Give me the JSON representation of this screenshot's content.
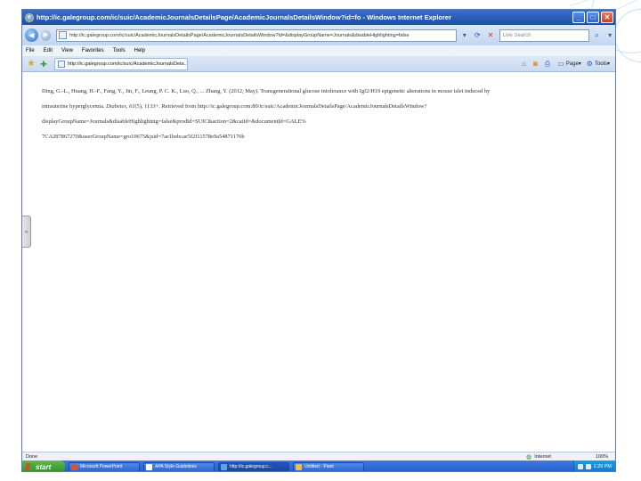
{
  "window": {
    "title": "http://ic.galegroup.com/ic/suic/AcademicJournalsDetailsPage/AcademicJournalsDetailsWindow?id=fo - Windows Internet Explorer",
    "minimize_symbol": "_",
    "maximize_symbol": "□",
    "close_symbol": "✕"
  },
  "address": {
    "url": "http://ic.galegroup.com/ic/suic/AcademicJournalsDetailsPage/AcademicJournalsDetailsWindow?id=&displayGroupName=Journals&disableHighlighting=false",
    "search_placeholder": "Live Search"
  },
  "menu": [
    "File",
    "Edit",
    "View",
    "Favorites",
    "Tools",
    "Help"
  ],
  "tab": {
    "title": "http://ic.galegroup.com/ic/suic/AcademicJournalsDeta..."
  },
  "command_bar": {
    "page_label": "Page",
    "tools_label": "Tools"
  },
  "citation": {
    "line1": "Ding, G.-L., Huang, H.-F., Fang, Y., Jin, F., Leung, P. C. K., Luo, Q., ... Zhang, Y. (2012, May). Transgenerational glucose intolerance with Igf2/H19 epigenetic alterations in mouse islet induced by",
    "line2_prefix": "intrauterine hyperglycemia. ",
    "journal": "Diabetes, 61",
    "line2_suffix": "(5), 1133+. Retrieved from http://ic.galegroup.com:80/ic/suic/AcademicJournalsDetailsPage/AcademicJournalsDetailsWindow?",
    "line3": "displayGroupName=Journals&disableHighlighting=false&prodId=SUIC&action=2&catId=&documentId=GALE%",
    "line4": "7CA287867270&userGroupName=gro10675&jsid=7ae1bebcae5f2f11578e9a54871176b"
  },
  "status": {
    "left": "Done",
    "zone": "Internet",
    "zoom": "100%"
  },
  "taskbar": {
    "start": "start",
    "tasks": [
      {
        "label": "Microsoft PowerPoint",
        "icon_color": "#d9542b"
      },
      {
        "label": "APA Style Guidelines",
        "icon_color": "#ffffff"
      },
      {
        "label": "http://ic.galegroup.c...",
        "icon_color": "#5aa7e8"
      },
      {
        "label": "Untitled - Paint",
        "icon_color": "#e8c14a"
      }
    ],
    "clock": "1:29 PM"
  }
}
